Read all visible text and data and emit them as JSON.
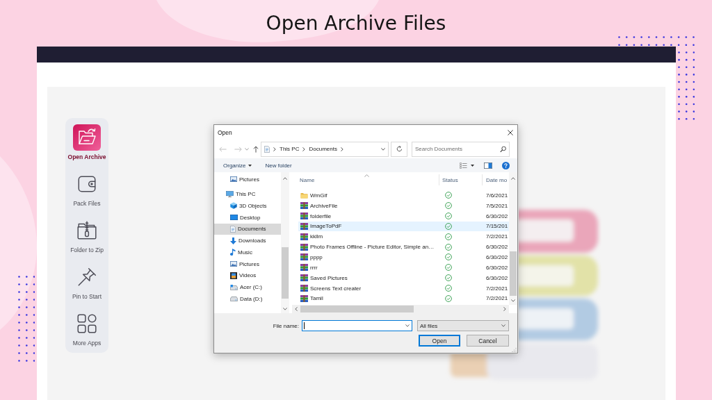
{
  "page": {
    "title": "Open Archive Files"
  },
  "sidebar": {
    "items": [
      {
        "label": "Open Archive",
        "selected": true
      },
      {
        "label": "Pack Files",
        "selected": false
      },
      {
        "label": "Folder to Zip",
        "selected": false
      },
      {
        "label": "Pin to Start",
        "selected": false
      },
      {
        "label": "More Apps",
        "selected": false
      }
    ]
  },
  "dialog": {
    "title": "Open",
    "navigation": {
      "back": {
        "disabled": true
      },
      "forward": {
        "disabled": true
      },
      "up": {
        "disabled": false
      }
    },
    "address": {
      "path": [
        "This PC",
        "Documents"
      ]
    },
    "search": {
      "placeholder": "Search Documents"
    },
    "toolbar": {
      "buttons": [
        {
          "label": "Organize",
          "kind": "menu"
        },
        {
          "label": "New folder",
          "kind": "plain"
        }
      ]
    },
    "nav_pane": {
      "quick_access": [
        {
          "label": "Pictures",
          "kind": "pictures",
          "selected": false
        }
      ],
      "tree": [
        {
          "label": "This PC",
          "kind": "pc",
          "selected": false,
          "children": [
            {
              "label": "3D Objects",
              "kind": "objects",
              "selected": false
            },
            {
              "label": "Desktop",
              "kind": "desktop",
              "selected": false
            },
            {
              "label": "Documents",
              "kind": "documents",
              "selected": true
            },
            {
              "label": "Downloads",
              "kind": "downloads",
              "selected": false
            },
            {
              "label": "Music",
              "kind": "music",
              "selected": false
            },
            {
              "label": "Pictures",
              "kind": "pictures",
              "selected": false
            },
            {
              "label": "Videos",
              "kind": "videos",
              "selected": false
            },
            {
              "label": "Acer (C:)",
              "kind": "system_drive",
              "selected": false
            },
            {
              "label": "Data (D:)",
              "kind": "drive",
              "selected": false
            }
          ]
        }
      ]
    },
    "file_list": {
      "columns": [
        "Name",
        "Status",
        "Date mo"
      ],
      "rows": [
        {
          "name": "WmGif",
          "kind": "folder",
          "synced": true,
          "date": "7/6/2021",
          "selected": false
        },
        {
          "name": "ArchiveFile",
          "kind": "archive",
          "synced": true,
          "date": "7/5/2021",
          "selected": false
        },
        {
          "name": "folderfile",
          "kind": "archive",
          "synced": true,
          "date": "6/30/202",
          "selected": false
        },
        {
          "name": "ImageToPdF",
          "kind": "archive",
          "synced": true,
          "date": "7/15/201",
          "selected": true
        },
        {
          "name": "kkllm",
          "kind": "archive",
          "synced": true,
          "date": "7/2/2021",
          "selected": false
        },
        {
          "name": "Photo Frames Offline - Picture Editor, Simple an…",
          "kind": "archive",
          "synced": true,
          "date": "6/30/202",
          "selected": false
        },
        {
          "name": "pppp",
          "kind": "archive",
          "synced": true,
          "date": "6/30/202",
          "selected": false
        },
        {
          "name": "rrrr",
          "kind": "archive",
          "synced": true,
          "date": "6/30/202",
          "selected": false
        },
        {
          "name": "Saved Pictures",
          "kind": "archive",
          "synced": true,
          "date": "6/30/202",
          "selected": false
        },
        {
          "name": "Screens Text creater",
          "kind": "archive",
          "synced": true,
          "date": "7/2/2021",
          "selected": false
        },
        {
          "name": "Tamil",
          "kind": "archive",
          "synced": true,
          "date": "7/2/2021",
          "selected": false
        }
      ]
    },
    "file_name": {
      "label": "File name:",
      "focused": true
    },
    "file_type": {
      "value": "All files"
    },
    "buttons": [
      {
        "label": "Open",
        "default": true
      },
      {
        "label": "Cancel",
        "default": false
      }
    ]
  }
}
